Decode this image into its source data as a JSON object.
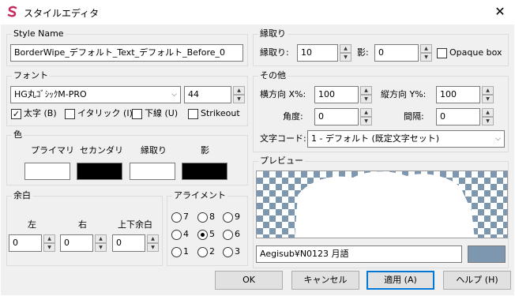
{
  "window": {
    "title": "スタイルエディタ",
    "close_glyph": "✕",
    "app_icon": "s-logo-icon"
  },
  "style_name": {
    "legend": "Style Name",
    "value": "BorderWipe_デフォルト_Text_デフォルト_Before_0"
  },
  "font": {
    "legend": "フォント",
    "family": "HG丸ｺﾞｼｯｸM-PRO",
    "size": "44",
    "bold": {
      "label": "太字 (B)",
      "checked": true
    },
    "italic": {
      "label": "イタリック (I)",
      "checked": false
    },
    "underline": {
      "label": "下線 (U)",
      "checked": false
    },
    "strikeout": {
      "label": "Strikeout",
      "checked": false
    }
  },
  "colors": {
    "legend": "色",
    "primary": {
      "label": "プライマリ",
      "color": "#ffffff"
    },
    "secondary": {
      "label": "セカンダリ",
      "color": "#000000"
    },
    "outline": {
      "label": "縁取り",
      "color": "#ffffff"
    },
    "shadow": {
      "label": "影",
      "color": "#000000"
    }
  },
  "margins": {
    "legend": "余白",
    "left_label": "左",
    "right_label": "右",
    "vertical_label": "上下余白",
    "left": "0",
    "right": "0",
    "vertical": "0"
  },
  "alignment": {
    "legend": "アライメント",
    "options": [
      "7",
      "8",
      "9",
      "4",
      "5",
      "6",
      "1",
      "2",
      "3"
    ],
    "selected": "5"
  },
  "outline": {
    "legend": "縁取り",
    "outline_label": "縁取り:",
    "outline_value": "10",
    "shadow_label": "影:",
    "shadow_value": "0",
    "opaque_label": "Opaque box",
    "opaque_checked": false
  },
  "misc": {
    "legend": "その他",
    "scale_x_label": "横方向 X%:",
    "scale_x": "100",
    "scale_y_label": "縦方向 Y%:",
    "scale_y": "100",
    "angle_label": "角度:",
    "angle": "0",
    "spacing_label": "間隔:",
    "spacing": "0",
    "encoding_label": "文字コード:",
    "encoding": "1 - デフォルト (既定文字セット)"
  },
  "preview": {
    "legend": "プレビュー",
    "text": "Aegisub¥N0123 月語",
    "bg_color": "#7d97b0",
    "checker_color": "#7d97b0"
  },
  "buttons": {
    "ok": "OK",
    "cancel": "キャンセル",
    "apply": "適用 (A)",
    "help": "ヘルプ (H)"
  }
}
